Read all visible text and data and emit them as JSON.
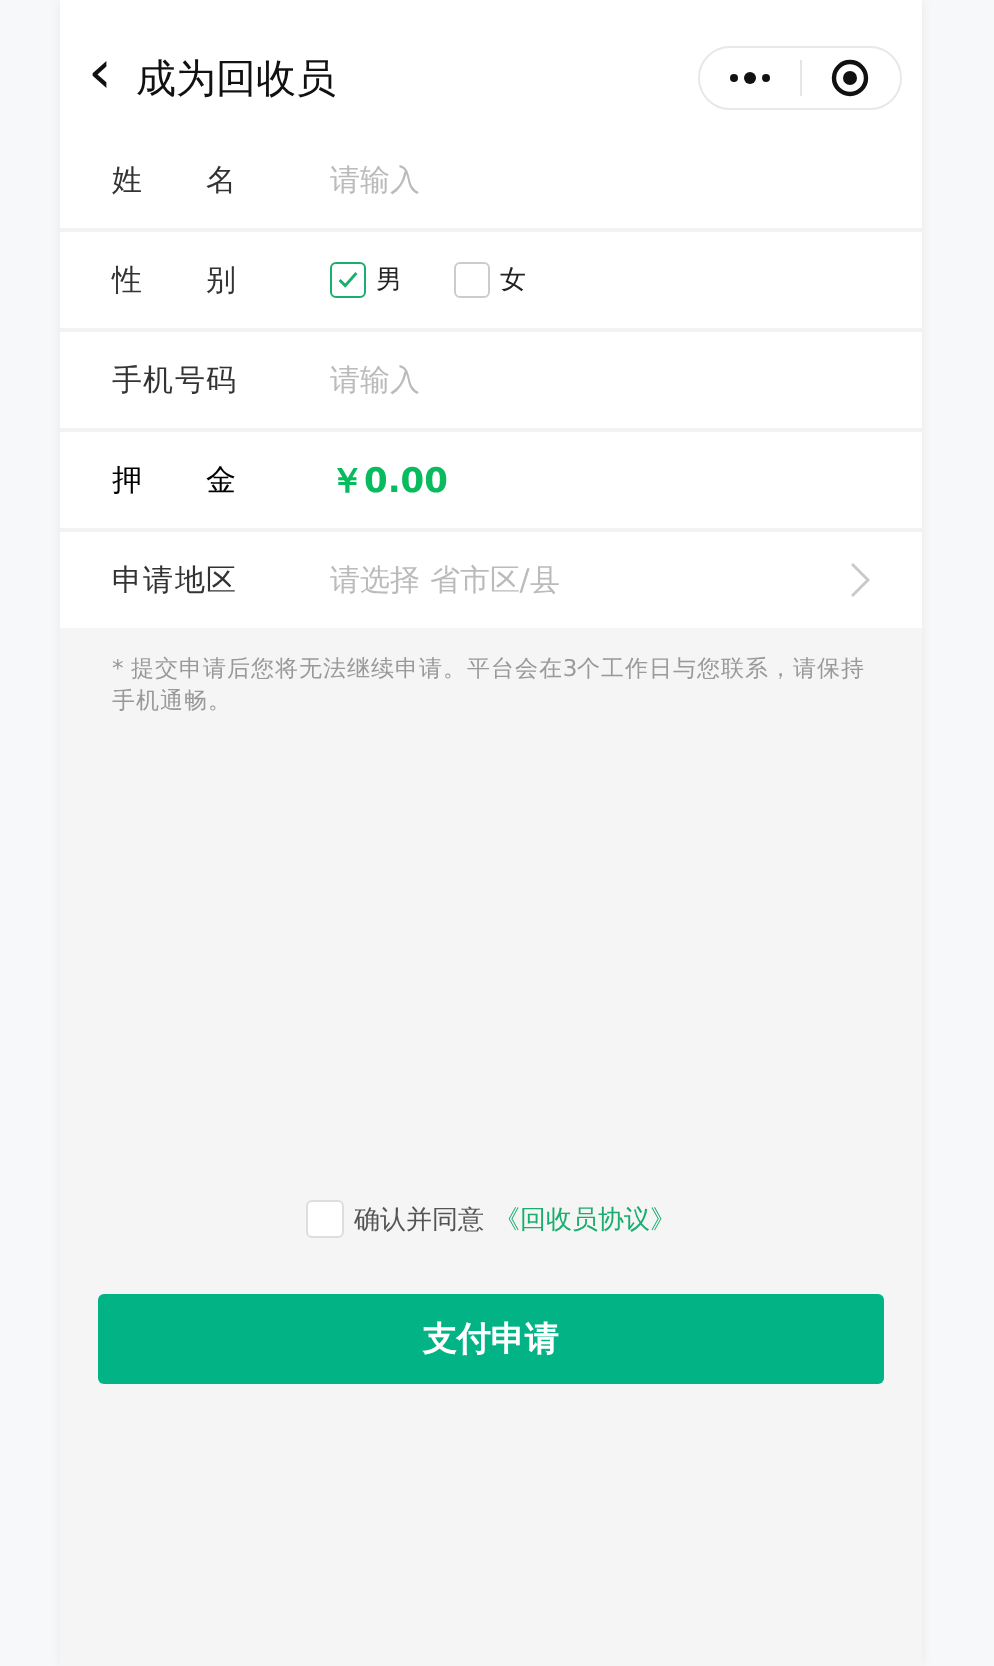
{
  "nav": {
    "back": "‹",
    "title": "成为回收员"
  },
  "form": [
    {
      "kind": "input",
      "label": "姓名",
      "placeholder": "请输入"
    },
    {
      "kind": "gender",
      "label": "性别",
      "options": [
        {
          "label": "男",
          "selected": true
        },
        {
          "label": "女",
          "selected": false
        }
      ]
    },
    {
      "kind": "input",
      "label": "手机号码",
      "placeholder": "请输入"
    },
    {
      "kind": "amount",
      "label": "押金",
      "value": "￥0.00"
    },
    {
      "kind": "picker",
      "label": "申请地区",
      "placeholder": "请选择 省市区/县"
    }
  ],
  "note": "* 提交申请后您将无法继续申请。平台会在3个工作日与您联系，请保持手机通畅。",
  "agreement": {
    "checked": false,
    "text": "确认并同意",
    "link": "《回收员协议》"
  },
  "submit": "支付申请"
}
